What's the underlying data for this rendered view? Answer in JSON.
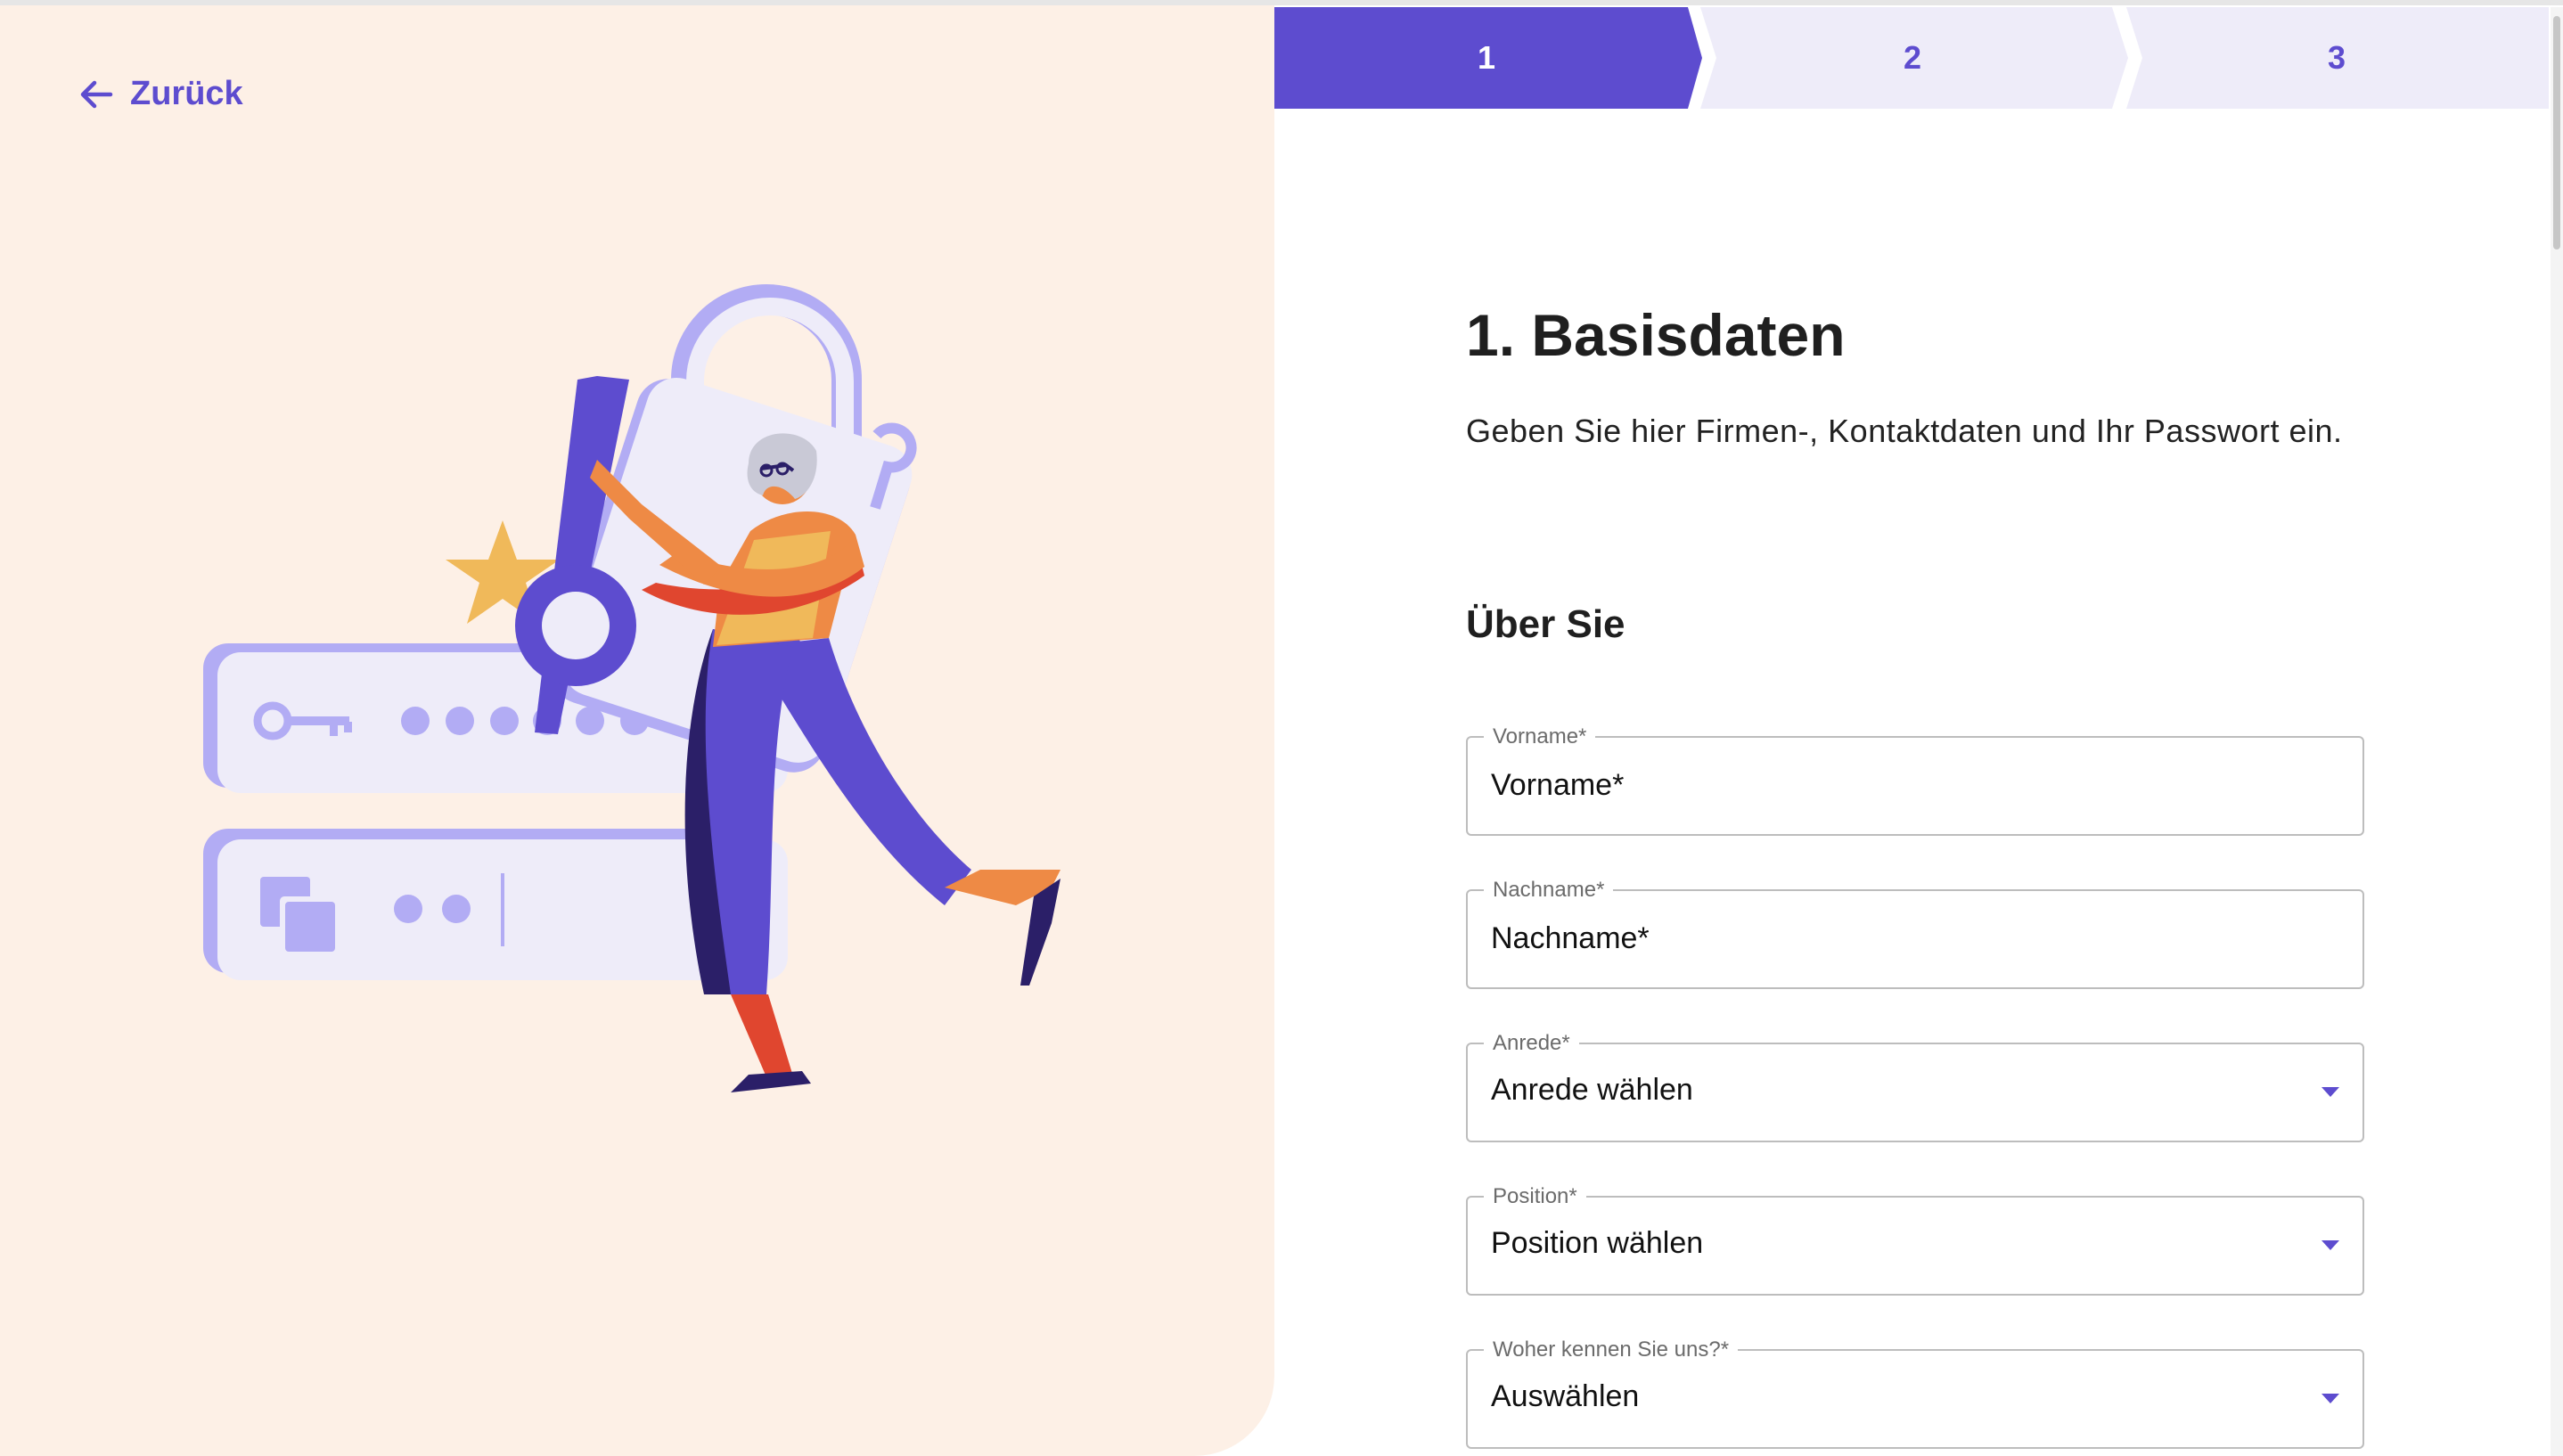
{
  "nav": {
    "back_label": "Zurück"
  },
  "stepper": {
    "steps": [
      "1",
      "2",
      "3"
    ],
    "active_step": 1,
    "colors": {
      "active": "#5d4ccf",
      "inactive": "#eeecf9",
      "active_text": "#ffffff",
      "inactive_text": "#5d4ccf"
    }
  },
  "form": {
    "title": "1. Basisdaten",
    "intro": "Geben Sie hier Firmen-, Kontaktdaten und Ihr Passwort ein.",
    "section_title": "Über Sie",
    "fields": [
      {
        "label": "Vorname*",
        "placeholder": "Vorname*",
        "type": "text"
      },
      {
        "label": "Nachname*",
        "placeholder": "Nachname*",
        "type": "text"
      },
      {
        "label": "Anrede*",
        "value": "Anrede wählen",
        "type": "select"
      },
      {
        "label": "Position*",
        "value": "Position wählen",
        "type": "select"
      },
      {
        "label": "Woher kennen Sie uns?*",
        "value": "Auswählen",
        "type": "select"
      }
    ]
  },
  "colors": {
    "accent": "#5d4ccf",
    "left_panel_bg": "#fdf0e6",
    "lavender": "#b2acf4",
    "light_lavender": "#eeecf9",
    "star": "#f0b95a",
    "orange": "#ee8a45",
    "red": "#e0462f",
    "navy": "#2b1f68"
  },
  "icons": {
    "back": "arrow-left-icon",
    "select": "triangle-down-icon"
  }
}
